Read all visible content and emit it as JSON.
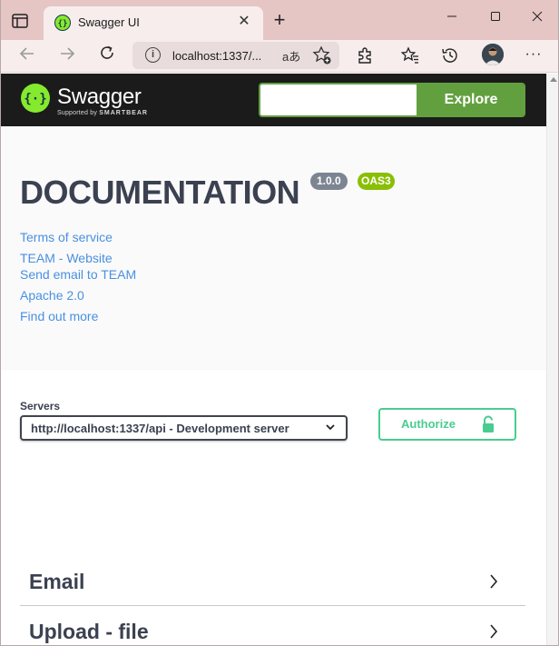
{
  "browser": {
    "tab_title": "Swagger UI",
    "tab_close": "✕",
    "new_tab": "+",
    "url": "localhost:1337/...",
    "read_aloud": "aあ",
    "menu": "···"
  },
  "swagger": {
    "brand": "Swagger",
    "tagline_prefix": "Supported by",
    "tagline_brand": "SMARTBEAR",
    "explore_value": "",
    "explore_label": "Explore",
    "accent_color": "#62a03f"
  },
  "info": {
    "title": "DOCUMENTATION",
    "version": "1.0.0",
    "oas": "OAS3",
    "links": [
      "Terms of service",
      "TEAM - Website",
      "Send email to TEAM",
      "Apache 2.0",
      "Find out more"
    ]
  },
  "servers": {
    "label": "Servers",
    "selected": "http://localhost:1337/api - Development server"
  },
  "authorize": {
    "label": "Authorize",
    "color": "#49cc90"
  },
  "tags": [
    {
      "name": "Email"
    },
    {
      "name": "Upload - file"
    }
  ]
}
